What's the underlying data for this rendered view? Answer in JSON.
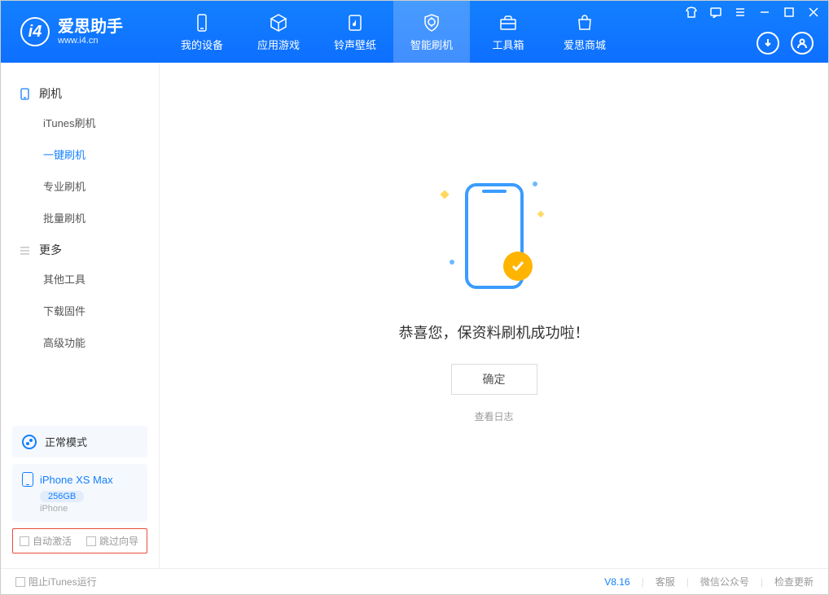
{
  "app": {
    "title": "爱思助手",
    "subtitle": "www.i4.cn"
  },
  "tabs": {
    "device": "我的设备",
    "apps": "应用游戏",
    "ring": "铃声壁纸",
    "flash": "智能刷机",
    "tools": "工具箱",
    "store": "爱思商城"
  },
  "sidebar": {
    "group1": "刷机",
    "items1": {
      "itunes": "iTunes刷机",
      "oneclick": "一键刷机",
      "pro": "专业刷机",
      "batch": "批量刷机"
    },
    "group2": "更多",
    "items2": {
      "other": "其他工具",
      "firmware": "下载固件",
      "advanced": "高级功能"
    }
  },
  "mode": {
    "label": "正常模式"
  },
  "device": {
    "name": "iPhone XS Max",
    "capacity": "256GB",
    "type": "iPhone"
  },
  "checks": {
    "auto_activate": "自动激活",
    "skip_guide": "跳过向导"
  },
  "main": {
    "success": "恭喜您，保资料刷机成功啦！",
    "ok": "确定",
    "log": "查看日志"
  },
  "status": {
    "block_itunes": "阻止iTunes运行",
    "version": "V8.16",
    "service": "客服",
    "wechat": "微信公众号",
    "update": "检查更新"
  }
}
